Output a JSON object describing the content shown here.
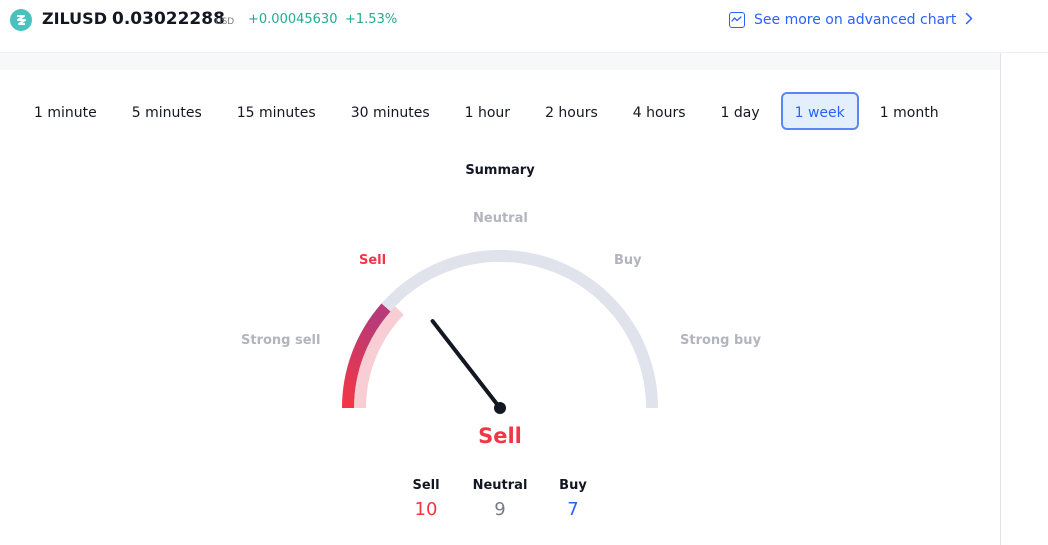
{
  "header": {
    "logo_icon": "zilliqa-logo-icon",
    "symbol": "ZILUSD",
    "price": "0.03022288",
    "currency": "USD",
    "change": "+0.00045630",
    "change_percent": "+1.53%",
    "advanced_chart_link": "See more on advanced chart",
    "advanced_chart_icon": "chart-line-icon",
    "chevron_icon": "chevron-right-icon"
  },
  "colors": {
    "accent": "#2962ff",
    "positive": "#22ab94",
    "sell": "#f23645",
    "neutral_text": "#787b86",
    "gauge_track": "#e0e3eb",
    "logo": "#49c1bf"
  },
  "intervals": {
    "items": [
      {
        "label": "1 minute",
        "active": false
      },
      {
        "label": "5 minutes",
        "active": false
      },
      {
        "label": "15 minutes",
        "active": false
      },
      {
        "label": "30 minutes",
        "active": false
      },
      {
        "label": "1 hour",
        "active": false
      },
      {
        "label": "2 hours",
        "active": false
      },
      {
        "label": "4 hours",
        "active": false
      },
      {
        "label": "1 day",
        "active": false
      },
      {
        "label": "1 week",
        "active": true
      },
      {
        "label": "1 month",
        "active": false
      }
    ]
  },
  "summary": {
    "title": "Summary",
    "gauge_labels": {
      "strong_sell": "Strong sell",
      "sell": "Sell",
      "neutral": "Neutral",
      "buy": "Buy",
      "strong_buy": "Strong buy"
    },
    "active_zone": "sell",
    "needle_fraction": 0.29,
    "filled_fraction": 0.23,
    "result": "Sell",
    "counts": [
      {
        "label": "Sell",
        "value": "10",
        "kind": "sell"
      },
      {
        "label": "Neutral",
        "value": "9",
        "kind": "neutral"
      },
      {
        "label": "Buy",
        "value": "7",
        "kind": "buy"
      }
    ]
  }
}
